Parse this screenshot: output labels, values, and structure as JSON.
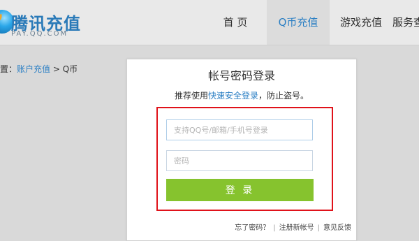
{
  "header": {
    "logo_title": "腾讯充值",
    "logo_sub": "PAY.QQ.COM",
    "nav": [
      "首 页",
      "Q币充值",
      "游戏充值",
      "服务查"
    ]
  },
  "breadcrumb": {
    "prefix": "置：",
    "link": "账户充值",
    "sep": " > ",
    "current": "Q币"
  },
  "login": {
    "title": "帐号密码登录",
    "tip_before": "推荐使用",
    "tip_link": "快速安全登录",
    "tip_after": "，防止盗号。",
    "username_placeholder": "支持QQ号/邮箱/手机号登录",
    "password_placeholder": "密码",
    "button": "登 录",
    "forgot": "忘了密码？",
    "register": "注册新帐号",
    "feedback": "意见反馈",
    "sep": "|"
  },
  "colors": {
    "brand_blue": "#2b7fc4",
    "button_green": "#86c32e",
    "highlight_red": "#e0121a"
  }
}
